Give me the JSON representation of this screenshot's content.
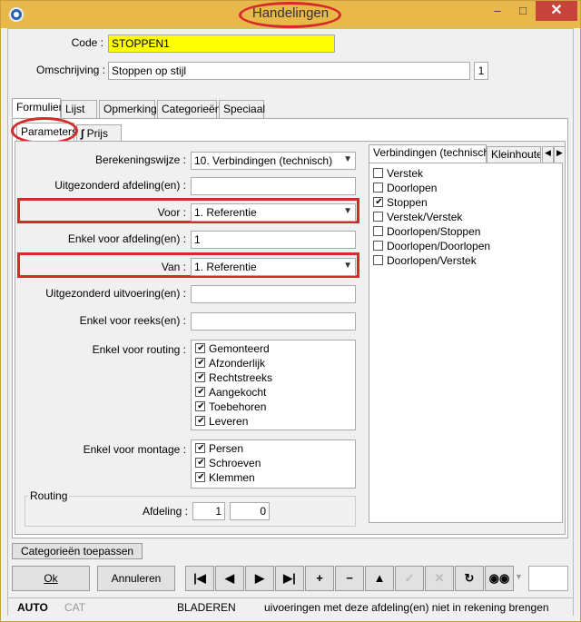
{
  "window": {
    "title": "Handelingen"
  },
  "form": {
    "code_label": "Code :",
    "code_value": "STOPPEN1",
    "omschrijving_label": "Omschrijving :",
    "omschrijving_value": "Stoppen op stijl",
    "omschrijving_counter": "1"
  },
  "tabs": [
    "Formulier",
    "Lijst",
    "Opmerking",
    "Categorieën",
    "Speciaal"
  ],
  "subtabs": [
    "Parameters",
    "Prijs"
  ],
  "params": {
    "berekeningswijze_label": "Berekeningswijze :",
    "berekeningswijze_value": "10. Verbindingen (technisch)",
    "uitgezonderd_afdeling_label": "Uitgezonderd afdeling(en) :",
    "uitgezonderd_afdeling_value": "",
    "voor_label": "Voor :",
    "voor_value": "1.  Referentie",
    "enkel_afdeling_label": "Enkel voor afdeling(en) :",
    "enkel_afdeling_value": "1",
    "van_label": "Van :",
    "van_value": "1.  Referentie",
    "uitgezonderd_uitvoering_label": "Uitgezonderd uitvoering(en) :",
    "uitgezonderd_uitvoering_value": "",
    "enkel_reeks_label": "Enkel voor reeks(en) :",
    "enkel_reeks_value": "",
    "routing_label": "Enkel voor routing :",
    "routing_items": [
      {
        "label": "Gemonteerd",
        "checked": true
      },
      {
        "label": "Afzonderlijk",
        "checked": true
      },
      {
        "label": "Rechtstreeks",
        "checked": true
      },
      {
        "label": "Aangekocht",
        "checked": true
      },
      {
        "label": "Toebehoren",
        "checked": true
      },
      {
        "label": "Leveren",
        "checked": true
      }
    ],
    "montage_label": "Enkel voor montage :",
    "montage_items": [
      {
        "label": "Persen",
        "checked": true
      },
      {
        "label": "Schroeven",
        "checked": true
      },
      {
        "label": "Klemmen",
        "checked": true
      }
    ],
    "routing_group_title": "Routing",
    "afdeling_label": "Afdeling :",
    "afdeling_from": "1",
    "afdeling_to": "0"
  },
  "right_panel": {
    "tab_active": "Verbindingen (technisch)",
    "tab_other": "Kleinhouten",
    "items": [
      {
        "label": "Verstek",
        "checked": false
      },
      {
        "label": "Doorlopen",
        "checked": false
      },
      {
        "label": "Stoppen",
        "checked": true
      },
      {
        "label": "Verstek/Verstek",
        "checked": false
      },
      {
        "label": "Doorlopen/Stoppen",
        "checked": false
      },
      {
        "label": "Doorlopen/Doorlopen",
        "checked": false
      },
      {
        "label": "Doorlopen/Verstek",
        "checked": false
      }
    ]
  },
  "buttons": {
    "categorieen_toepassen": "Categorieën toepassen",
    "ok": "Ok",
    "annuleren": "Annuleren"
  },
  "status": {
    "auto": "AUTO",
    "cat": "CAT",
    "mode": "BLADEREN",
    "message": "uivoeringen met deze afdeling(en) niet in rekening brengen"
  },
  "colors": {
    "accent_red": "#d42a2a",
    "code_bg": "#ffff00",
    "title_bg": "#e8b94a"
  }
}
